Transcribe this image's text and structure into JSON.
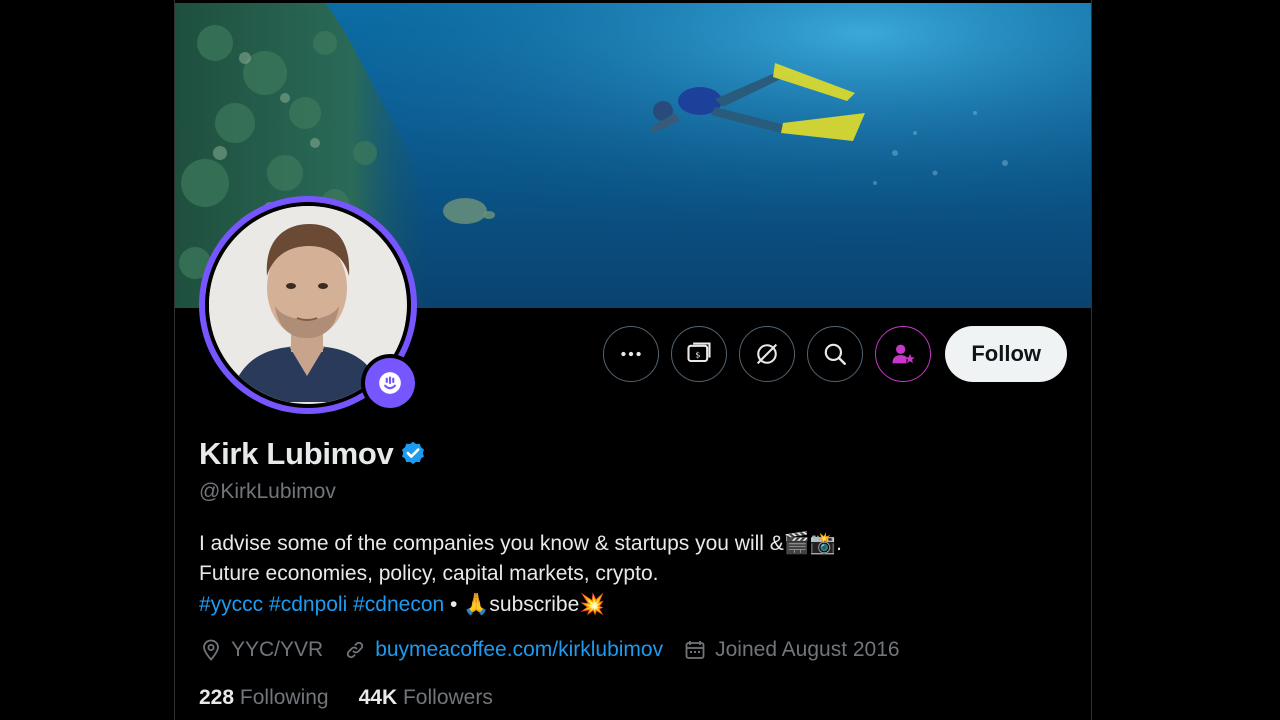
{
  "profile": {
    "name": "Kirk Lubimov",
    "handle": "@KirkLubimov",
    "verified_icon": "verified-badge-icon",
    "bio": {
      "line1": "I advise some of the companies you know & startups you will &",
      "line1_emoji": "🎬📸",
      "line1_end": ".",
      "line2": "Future economies, policy, capital markets, crypto.",
      "tags": [
        "#yyccc",
        "#cdnpoli",
        "#cdnecon"
      ],
      "separator": "•",
      "pray_emoji": "🙏",
      "subscribe": "subscribe",
      "boom_emoji": "💥"
    },
    "location": "YYC/YVR",
    "website": "buymeacoffee.com/kirklubimov",
    "joined": "Joined August 2016",
    "following_count": "228",
    "following_label": "Following",
    "followers_count": "44K",
    "followers_label": "Followers"
  },
  "actions": {
    "follow_label": "Follow",
    "icons": [
      "more-icon",
      "message-icon",
      "grok-icon",
      "search-icon",
      "subscribe-icon"
    ]
  },
  "colors": {
    "accent": "#1d9bf0",
    "avatar_ring": "#7856ff",
    "subscribe_border": "#c936c9",
    "background": "#000000"
  }
}
